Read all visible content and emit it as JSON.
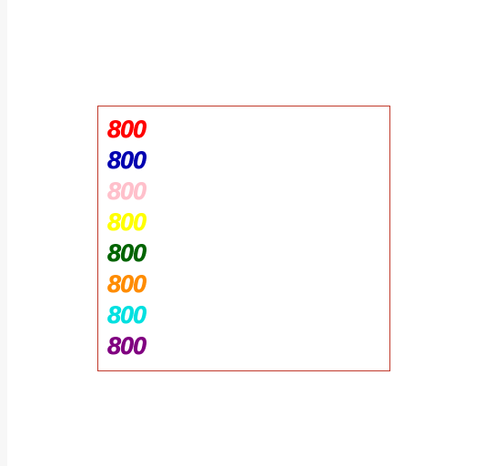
{
  "box": {
    "lines": [
      {
        "value": "800",
        "color": "#ff0000"
      },
      {
        "value": "800",
        "color": "#0000b0"
      },
      {
        "value": "800",
        "color": "#ffc0cb"
      },
      {
        "value": "800",
        "color": "#ffff00"
      },
      {
        "value": "800",
        "color": "#006400"
      },
      {
        "value": "800",
        "color": "#ff8c00"
      },
      {
        "value": "800",
        "color": "#00e0e0"
      },
      {
        "value": "800",
        "color": "#800080"
      }
    ]
  }
}
